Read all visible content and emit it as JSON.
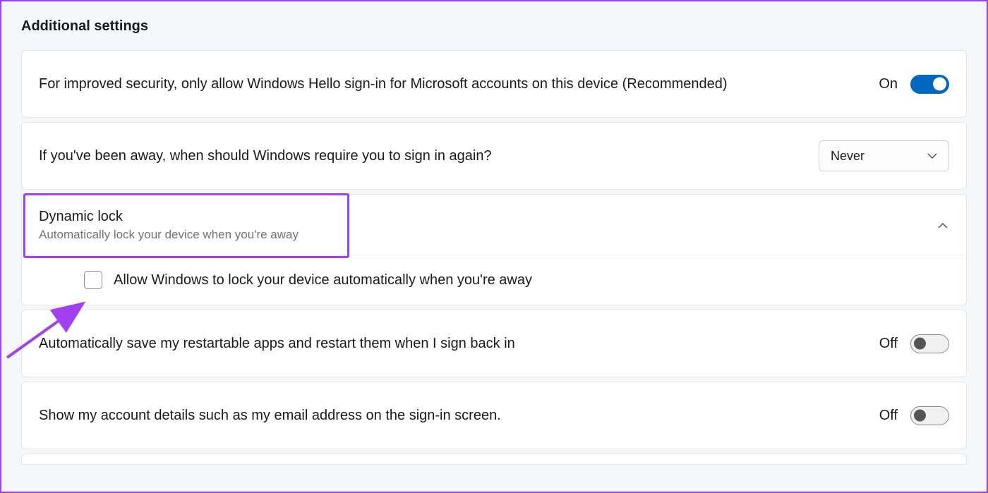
{
  "section": {
    "title": "Additional settings"
  },
  "row1": {
    "label": "For improved security, only allow Windows Hello sign-in for Microsoft accounts on this device (Recommended)",
    "state": "On"
  },
  "row2": {
    "label": "If you've been away, when should Windows require you to sign in again?",
    "select_value": "Never"
  },
  "row3": {
    "title": "Dynamic lock",
    "subtitle": "Automatically lock your device when you're away",
    "checkbox_label": "Allow Windows to lock your device automatically when you're away"
  },
  "row4": {
    "label": "Automatically save my restartable apps and restart them when I sign back in",
    "state": "Off"
  },
  "row5": {
    "label": "Show my account details such as my email address on the sign-in screen.",
    "state": "Off"
  }
}
